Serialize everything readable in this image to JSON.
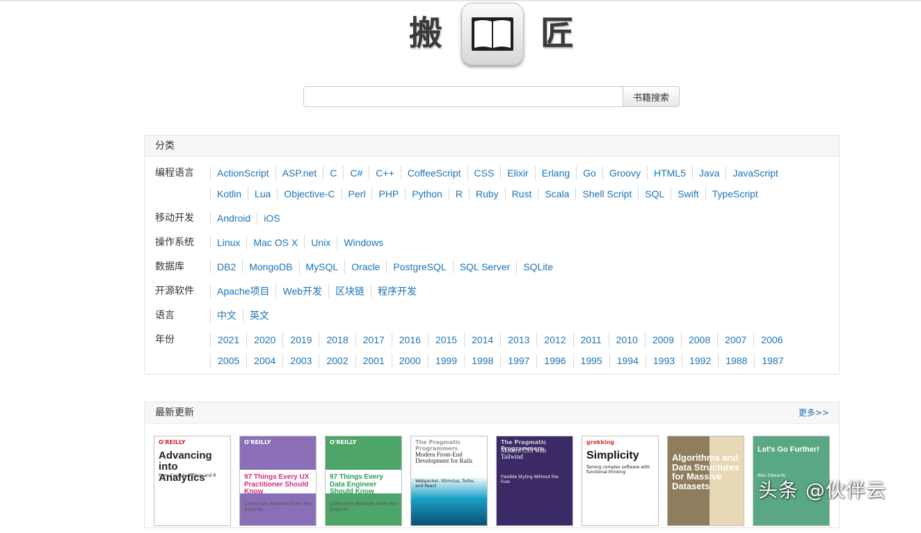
{
  "logo": {
    "left_char": "搬",
    "right_char": "匠",
    "icon": "book-icon"
  },
  "search": {
    "placeholder": "",
    "value": "",
    "button_label": "书籍搜索"
  },
  "categories": {
    "header": "分类",
    "rows": [
      {
        "label": "编程语言",
        "lines": [
          [
            "ActionScript",
            "ASP.net",
            "C",
            "C#",
            "C++",
            "CoffeeScript",
            "CSS",
            "Elixir",
            "Erlang",
            "Go",
            "Groovy",
            "HTML5",
            "Java",
            "JavaScript"
          ],
          [
            "Kotlin",
            "Lua",
            "Objective-C",
            "Perl",
            "PHP",
            "Python",
            "R",
            "Ruby",
            "Rust",
            "Scala",
            "Shell Script",
            "SQL",
            "Swift",
            "TypeScript"
          ]
        ]
      },
      {
        "label": "移动开发",
        "lines": [
          [
            "Android",
            "iOS"
          ]
        ]
      },
      {
        "label": "操作系统",
        "lines": [
          [
            "Linux",
            "Mac OS X",
            "Unix",
            "Windows"
          ]
        ]
      },
      {
        "label": "数据库",
        "lines": [
          [
            "DB2",
            "MongoDB",
            "MySQL",
            "Oracle",
            "PostgreSQL",
            "SQL Server",
            "SQLite"
          ]
        ]
      },
      {
        "label": "开源软件",
        "lines": [
          [
            "Apache项目",
            "Web开发",
            "区块链",
            "程序开发"
          ]
        ]
      },
      {
        "label": "语言",
        "lines": [
          [
            "中文",
            "英文"
          ]
        ]
      },
      {
        "label": "年份",
        "lines": [
          [
            "2021",
            "2020",
            "2019",
            "2018",
            "2017",
            "2016",
            "2015",
            "2014",
            "2013",
            "2012",
            "2011",
            "2010",
            "2009",
            "2008",
            "2007",
            "2006"
          ],
          [
            "2005",
            "2004",
            "2003",
            "2002",
            "2001",
            "2000",
            "1999",
            "1998",
            "1997",
            "1996",
            "1995",
            "1994",
            "1993",
            "1992",
            "1988",
            "1987"
          ]
        ]
      }
    ]
  },
  "latest": {
    "header": "最新更新",
    "more": "更多>>",
    "books": [
      {
        "publisher": "O'REILLY",
        "title": "Advancing into Analytics",
        "subtitle": "From Excel to Python and R"
      },
      {
        "publisher": "O'REILLY",
        "title": "97 Things Every UX Practitioner Should Know",
        "subtitle": "Collective Wisdom from the Experts"
      },
      {
        "publisher": "O'REILLY",
        "title": "97 Things Every Data Engineer Should Know",
        "subtitle": "Collective Wisdom from the Experts"
      },
      {
        "publisher": "The Pragmatic Programmers",
        "title": "Modern Front-End Development for Rails",
        "subtitle": "Webpacker, Stimulus, Turbo, and React"
      },
      {
        "publisher": "The Pragmatic Programmers",
        "title": "Modern CSS with Tailwind",
        "subtitle": "Flexible Styling Without the Fuss"
      },
      {
        "publisher": "grokking",
        "title": "Simplicity",
        "subtitle": "Taming complex software with functional thinking"
      },
      {
        "publisher": "",
        "title": "Algorithms and Data Structures for Massive Datasets",
        "subtitle": ""
      },
      {
        "publisher": "",
        "title": "Let's Go Further!",
        "subtitle": "Alex Edwards"
      }
    ]
  },
  "watermark": "头条 @伙伴云",
  "colors": {
    "link": "#1a73b8",
    "panel_header_bg": "#f7f7f7",
    "border": "#e4e4e4"
  }
}
